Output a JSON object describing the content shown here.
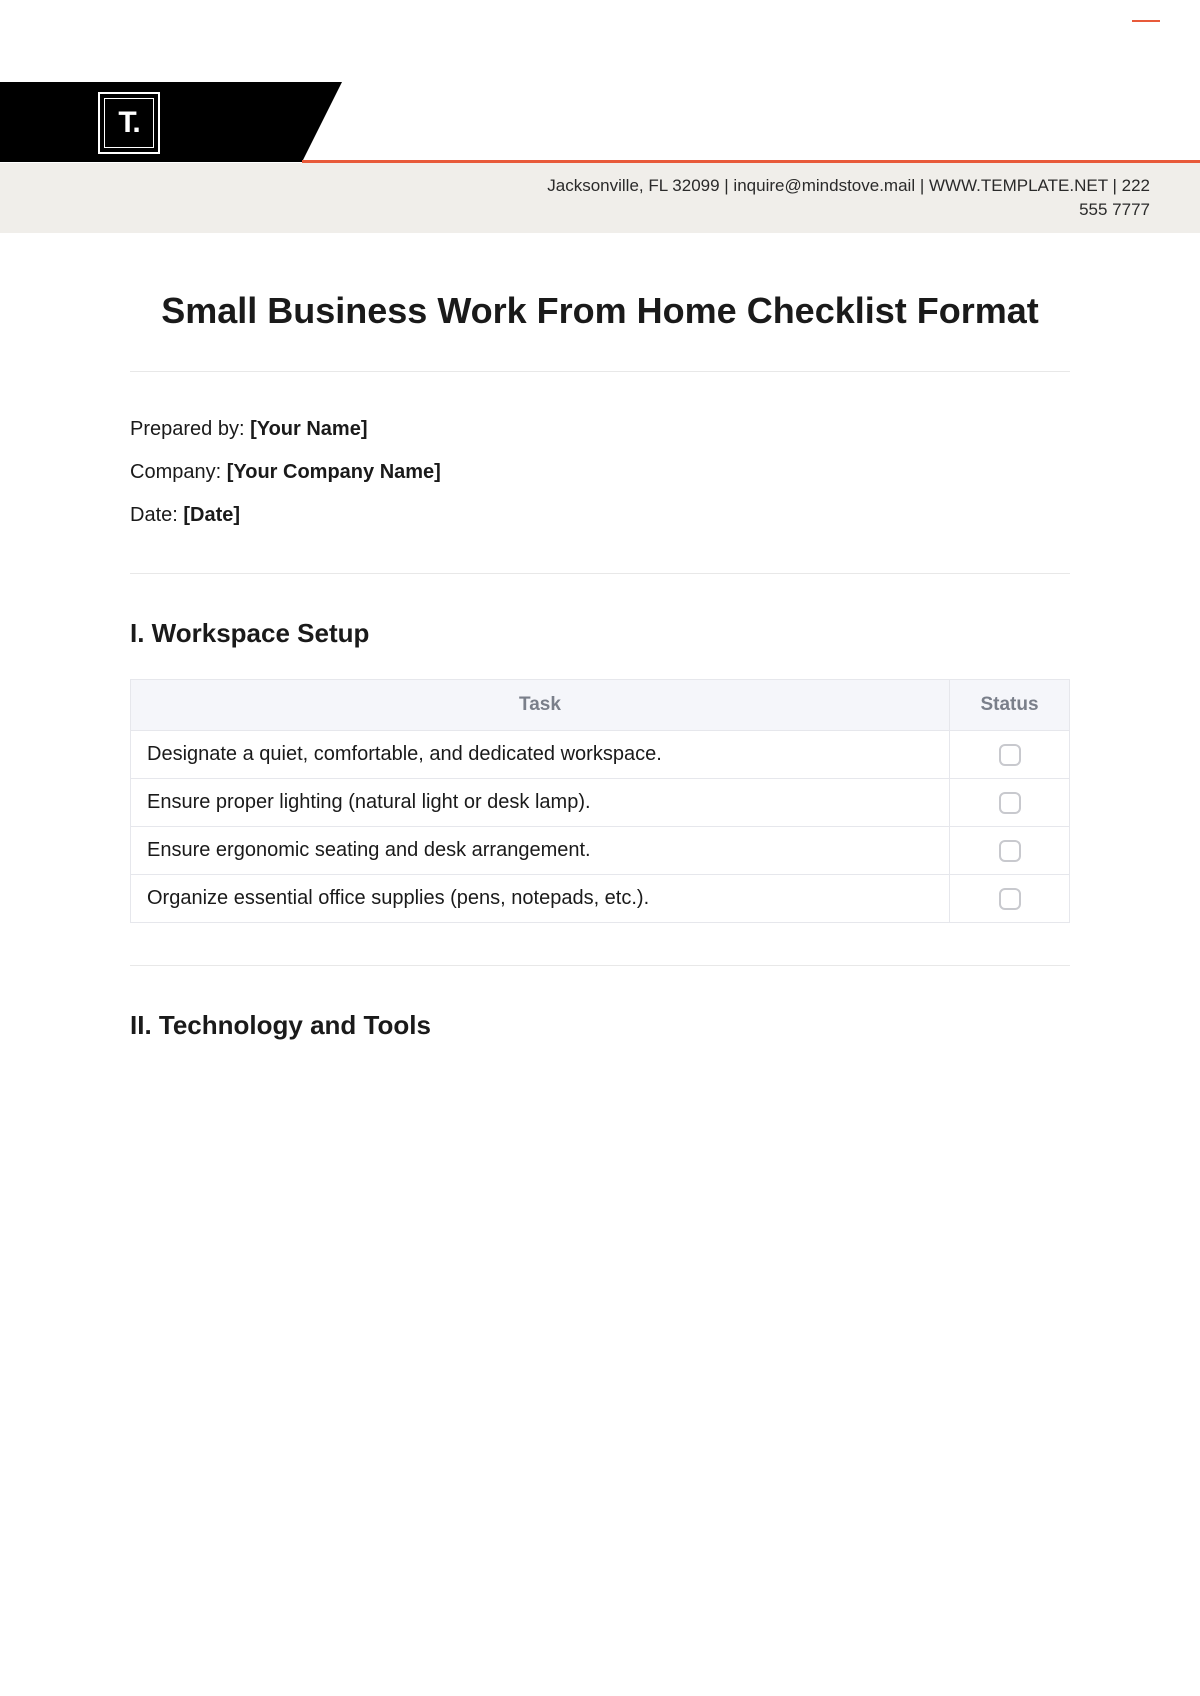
{
  "header": {
    "logo_text": "T.",
    "contact_line": "Jacksonville, FL 32099 | inquire@mindstove.mail | WWW.TEMPLATE.NET | 222 555 7777"
  },
  "title": "Small Business Work From Home Checklist Format",
  "meta": {
    "prepared_label": "Prepared by: ",
    "prepared_value": "[Your Name]",
    "company_label": "Company: ",
    "company_value": "[Your Company Name]",
    "date_label": "Date: ",
    "date_value": "[Date]"
  },
  "sections": {
    "s1": {
      "title": "I. Workspace Setup",
      "columns": {
        "task": "Task",
        "status": "Status"
      },
      "rows": [
        "Designate a quiet, comfortable, and dedicated workspace.",
        "Ensure proper lighting (natural light or desk lamp).",
        "Ensure ergonomic seating and desk arrangement.",
        "Organize essential office supplies (pens, notepads, etc.)."
      ]
    },
    "s2": {
      "title": "II. Technology and Tools"
    }
  }
}
